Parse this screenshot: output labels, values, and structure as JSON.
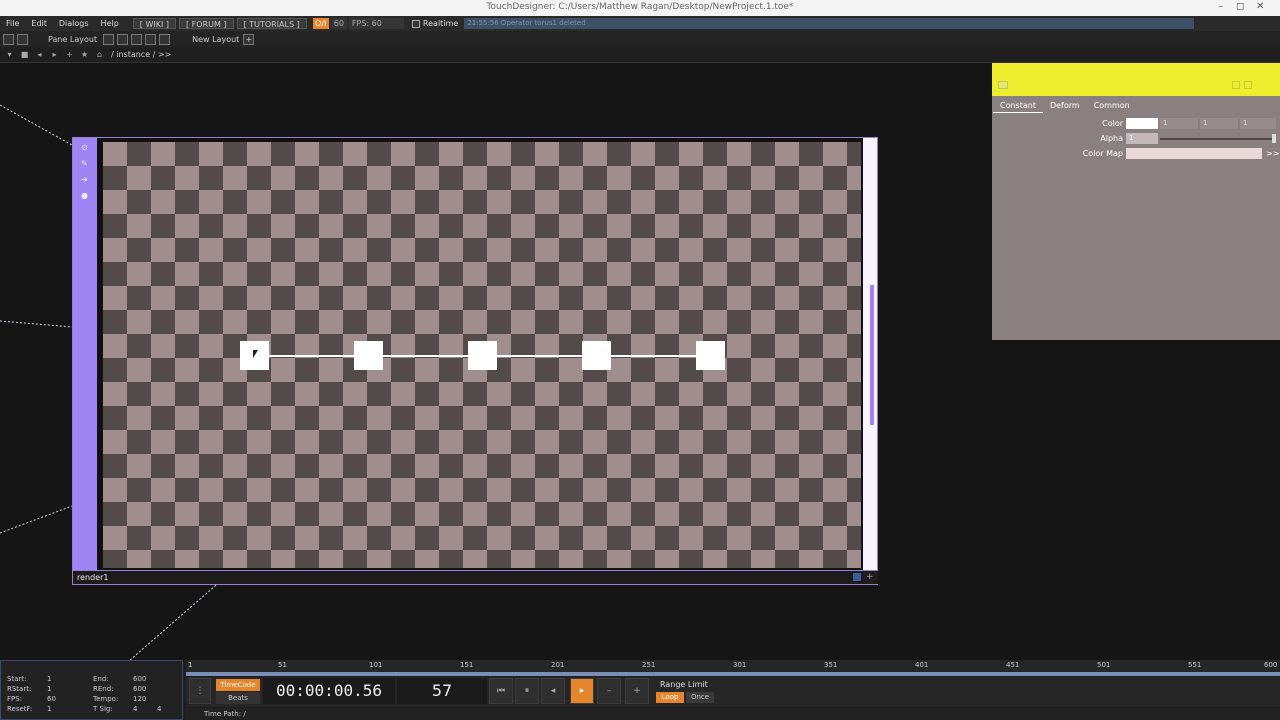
{
  "window": {
    "title": "TouchDesigner: C:/Users/Matthew Ragan/Desktop/NewProject.1.toe*",
    "minimize": "–",
    "maximize": "◻",
    "close": "✕"
  },
  "menu": {
    "items": [
      "File",
      "Edit",
      "Dialogs",
      "Help"
    ],
    "wiki": "[ WIKI ]",
    "forum": "[ FORUM ]",
    "tutorials": "[ TUTORIALS ]",
    "oi": "O/I",
    "fps_value": "60",
    "fps_label": "FPS: 60",
    "realtime": "Realtime",
    "status": "21:55:56 Operator torus1 deleted"
  },
  "panebar": {
    "pane_layout": "Pane Layout",
    "new_layout": "New Layout",
    "plus": "+"
  },
  "pathbar": {
    "path": "/ instance / >>"
  },
  "viewer": {
    "label": "render1"
  },
  "params": {
    "tabs": [
      "Constant",
      "Deform",
      "Common"
    ],
    "color_label": "Color",
    "color_r": "1",
    "color_g": "1",
    "color_b": "1",
    "alpha_label": "Alpha",
    "alpha_value": "1",
    "colormap_label": "Color Map",
    "colormap_arrow": ">>"
  },
  "time": {
    "start_label": "Start:",
    "start": "1",
    "end_label": "End:",
    "end": "600",
    "rstart_label": "RStart:",
    "rstart": "1",
    "rend_label": "REnd:",
    "rend": "600",
    "fps_label": "FPS:",
    "fps": "60",
    "tempo_label": "Tempo:",
    "tempo": "120",
    "resetf_label": "ResetF:",
    "resetf": "1",
    "tsig_label": "T Sig:",
    "tsig_a": "4",
    "tsig_b": "4",
    "ruler_ticks": [
      "1",
      "51",
      "101",
      "151",
      "201",
      "251",
      "301",
      "351",
      "401",
      "451",
      "501",
      "551",
      "600"
    ],
    "timecode_label": "TimeCode",
    "beats_label": "Beats",
    "timecode": "00:00:00.56",
    "frame": "57",
    "range_limit": "Range Limit",
    "loop": "Loop",
    "once": "Once",
    "time_path": "Time Path: /"
  },
  "colors": {
    "accent_orange": "#e5862c",
    "viewer_purple": "#9f84f3",
    "params_header_yellow": "#eeee2e",
    "params_bg": "#8a8080"
  }
}
